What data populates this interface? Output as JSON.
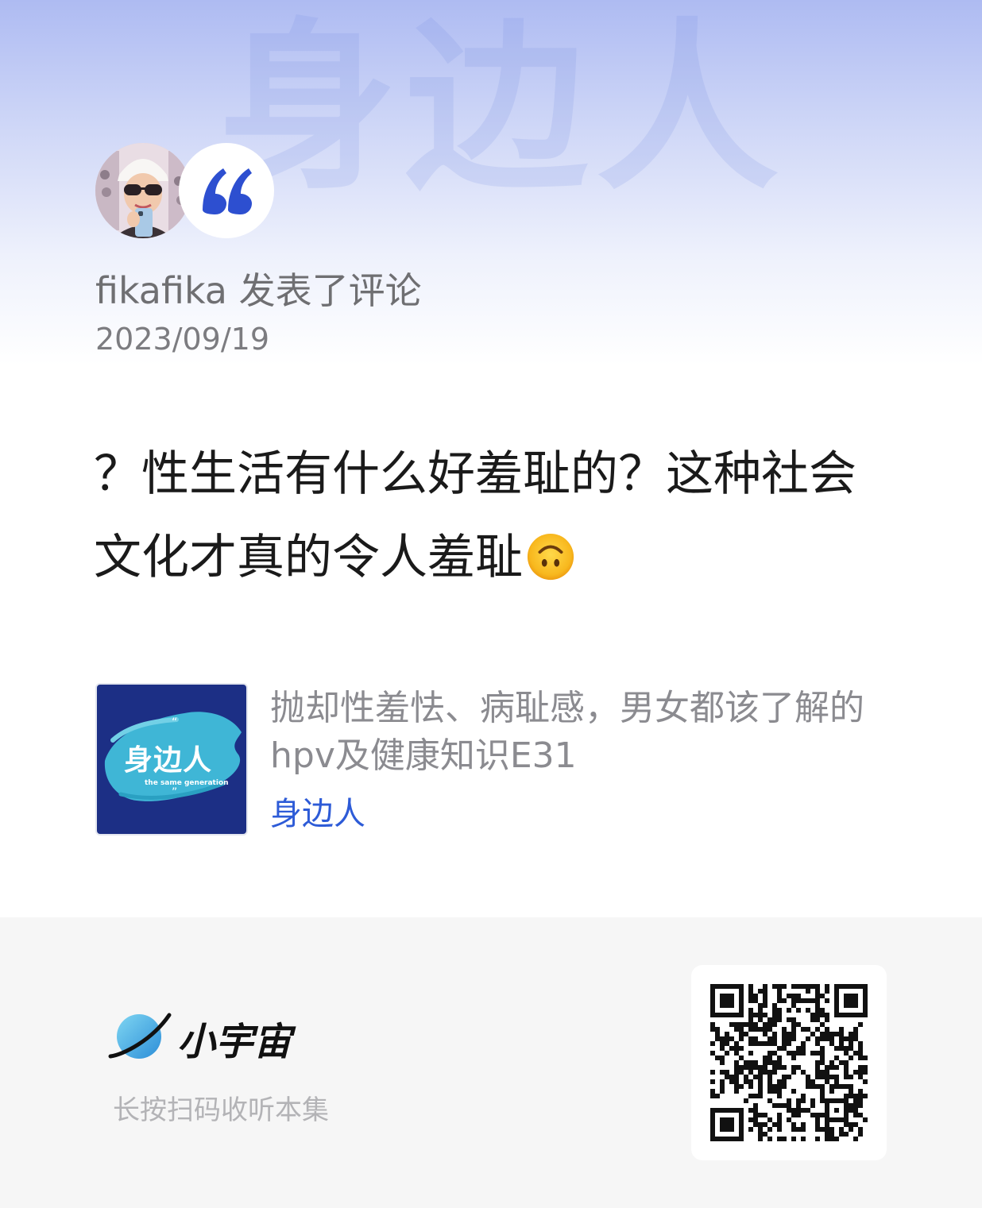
{
  "header": {
    "watermark": "身边人"
  },
  "comment_card": {
    "author": "fikafika",
    "action": "发表了评论",
    "date": "2023/09/19",
    "text": "？性生活有什么好羞耻的？这种社会文化才真的令人羞耻",
    "emoji": "upside-down-face-icon"
  },
  "episode": {
    "cover_title": "身边人",
    "cover_subtitle": "the same generation",
    "title": "抛却性羞怯、病耻感，男女都该了解的hpv及健康知识E31",
    "podcast": "身边人"
  },
  "footer": {
    "brand_name": "小宇宙",
    "scan_hint": "长按扫码收听本集"
  },
  "colors": {
    "accent_blue": "#2d5bd7",
    "cover_blue": "#1c2f85",
    "header_gradient_top": "#aebbf2",
    "footer_bg": "#f6f6f6"
  }
}
